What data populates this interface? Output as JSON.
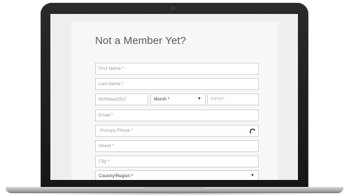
{
  "form": {
    "title": "Not a Member Yet?",
    "first_name_placeholder": "First Name *",
    "last_name_placeholder": "Last Name *",
    "birthday_placeholder": "Birthday(DD)*",
    "month_value": "Month *",
    "year_placeholder": "YYYY*",
    "email_placeholder": "Email *",
    "phone_placeholder": "Primary Phone *",
    "street_placeholder": "Street *",
    "city_placeholder": "City *",
    "country_value": "Country/Region *",
    "dropdown_glyph": "▼"
  }
}
